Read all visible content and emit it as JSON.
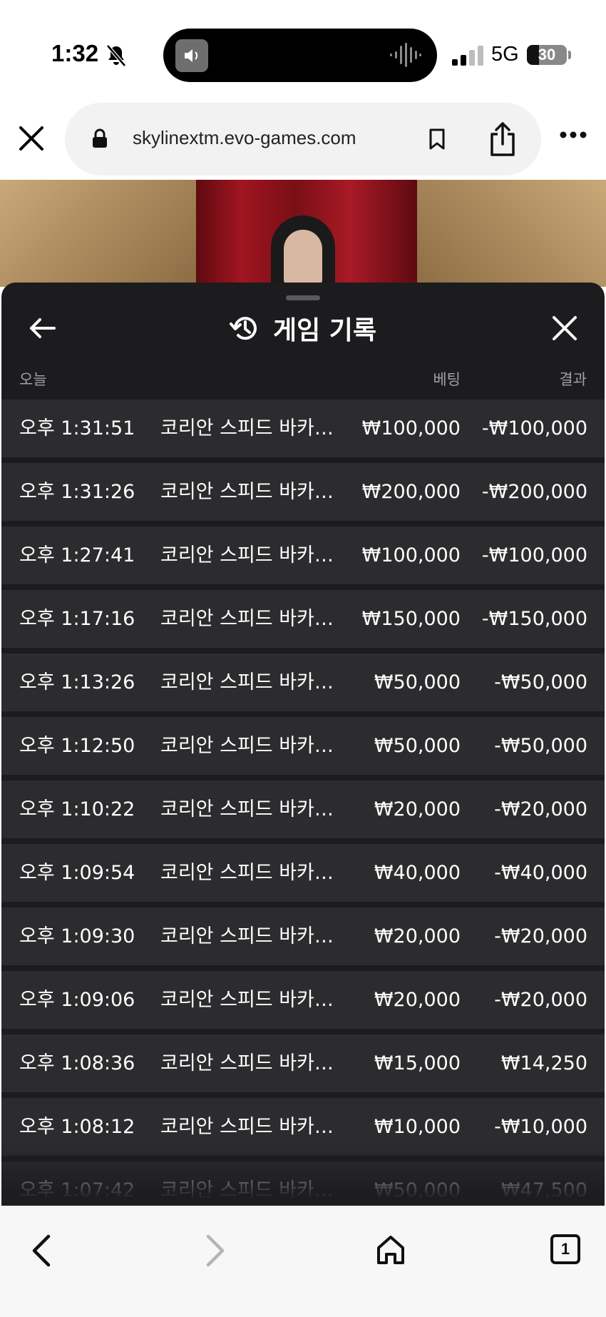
{
  "status_bar": {
    "time": "1:32",
    "network": "5G",
    "battery_percent": 30,
    "battery_label": "30"
  },
  "browser": {
    "url": "skylinextm.evo-games.com",
    "tab_count": "1"
  },
  "panel": {
    "title": "게임 기록",
    "columns": {
      "date": "오늘",
      "bet": "베팅",
      "result": "결과"
    },
    "rows": [
      {
        "time": "오후 1:31:51",
        "game": "코리안 스피드 바카라 B",
        "bet": "₩100,000",
        "result": "-₩100,000"
      },
      {
        "time": "오후 1:31:26",
        "game": "코리안 스피드 바카라 B",
        "bet": "₩200,000",
        "result": "-₩200,000"
      },
      {
        "time": "오후 1:27:41",
        "game": "코리안 스피드 바카라...",
        "bet": "₩100,000",
        "result": "-₩100,000"
      },
      {
        "time": "오후 1:17:16",
        "game": "코리안 스피드 바카라...",
        "bet": "₩150,000",
        "result": "-₩150,000"
      },
      {
        "time": "오후 1:13:26",
        "game": "코리안 스피드 바카라 B",
        "bet": "₩50,000",
        "result": "-₩50,000"
      },
      {
        "time": "오후 1:12:50",
        "game": "코리안 스피드 바카라...",
        "bet": "₩50,000",
        "result": "-₩50,000"
      },
      {
        "time": "오후 1:10:22",
        "game": "코리안 스피드 바카라 B",
        "bet": "₩20,000",
        "result": "-₩20,000"
      },
      {
        "time": "오후 1:09:54",
        "game": "코리안 스피드 바카라 B",
        "bet": "₩40,000",
        "result": "-₩40,000"
      },
      {
        "time": "오후 1:09:30",
        "game": "코리안 스피드 바카라 B",
        "bet": "₩20,000",
        "result": "-₩20,000"
      },
      {
        "time": "오후 1:09:06",
        "game": "코리안 스피드 바카라 B",
        "bet": "₩20,000",
        "result": "-₩20,000"
      },
      {
        "time": "오후 1:08:36",
        "game": "코리안 스피드 바카라 B",
        "bet": "₩15,000",
        "result": "₩14,250"
      },
      {
        "time": "오후 1:08:12",
        "game": "코리안 스피드 바카라 B",
        "bet": "₩10,000",
        "result": "-₩10,000"
      },
      {
        "time": "오후 1:07:42",
        "game": "코리안 스피드 바카라 B",
        "bet": "₩50,000",
        "result": "₩47,500"
      }
    ]
  },
  "icons": {
    "status": [
      "bell-slash-icon",
      "speaker-icon",
      "waveform-icon",
      "signal-icon",
      "battery-icon"
    ],
    "browser": [
      "close-icon",
      "lock-icon",
      "bookmark-icon",
      "share-icon",
      "more-icon"
    ],
    "panel": [
      "back-arrow-icon",
      "history-icon",
      "close-icon"
    ],
    "toolbar": [
      "chevron-left-icon",
      "chevron-right-icon",
      "home-icon",
      "tabs-icon"
    ]
  },
  "colors": {
    "panel_bg": "#1c1c1e",
    "row_bg": "#2c2c2e",
    "header_text": "#a0a0a5"
  }
}
